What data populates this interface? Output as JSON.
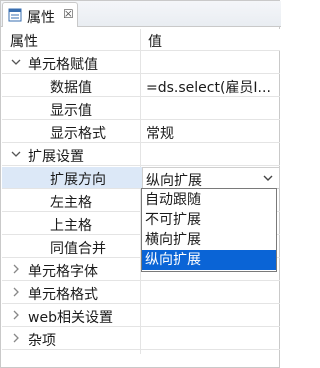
{
  "tab": {
    "title": "属性",
    "close": "☒"
  },
  "header": {
    "property": "属性",
    "value": "值"
  },
  "rows": [
    {
      "label": "单元格赋值",
      "value": ""
    },
    {
      "label": "数据值",
      "value": "=ds.select(雇员I..."
    },
    {
      "label": "显示值",
      "value": ""
    },
    {
      "label": "显示格式",
      "value": "常规"
    },
    {
      "label": "扩展设置",
      "value": ""
    },
    {
      "label": "扩展方向",
      "value": "纵向扩展"
    },
    {
      "label": "左主格",
      "value": ""
    },
    {
      "label": "上主格",
      "value": ""
    },
    {
      "label": "同值合并",
      "value": ""
    },
    {
      "label": "单元格字体",
      "value": ""
    },
    {
      "label": "单元格格式",
      "value": ""
    },
    {
      "label": "web相关设置",
      "value": ""
    },
    {
      "label": "杂项",
      "value": ""
    }
  ],
  "dropdown": {
    "options": [
      "自动跟随",
      "不可扩展",
      "横向扩展",
      "纵向扩展"
    ],
    "selected": "纵向扩展"
  },
  "colors": {
    "selection": "#0a64d6",
    "row_highlight": "#dce8f7",
    "grid": "#e4e4e4"
  }
}
